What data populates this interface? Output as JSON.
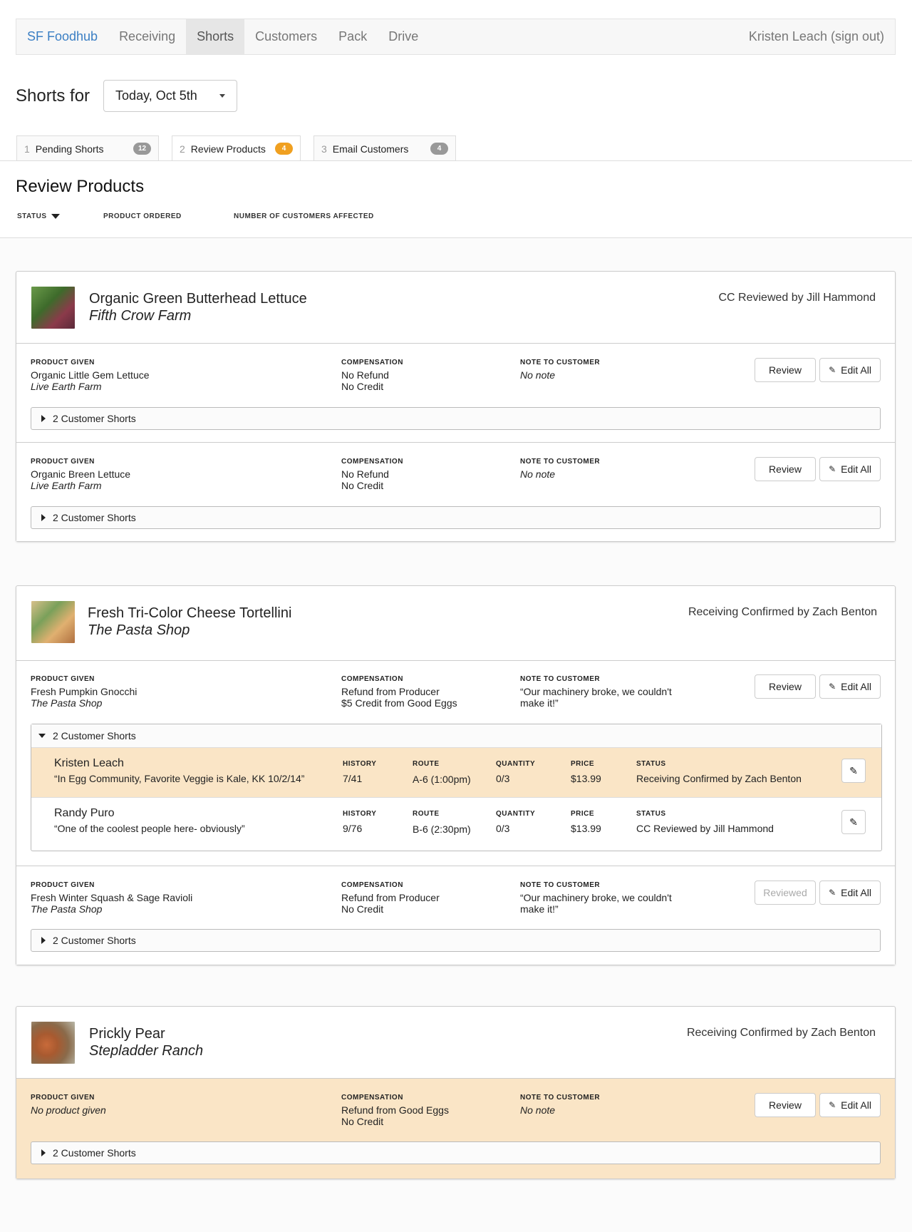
{
  "nav": {
    "brand": "SF Foodhub",
    "items": [
      "Receiving",
      "Shorts",
      "Customers",
      "Pack",
      "Drive"
    ],
    "user": "Kristen Leach (sign out)"
  },
  "header": {
    "title": "Shorts for",
    "date": "Today, Oct 5th"
  },
  "tabs": [
    {
      "num": "1",
      "label": "Pending Shorts",
      "badge": "12"
    },
    {
      "num": "2",
      "label": "Review Products",
      "badge": "4"
    },
    {
      "num": "3",
      "label": "Email Customers",
      "badge": "4"
    }
  ],
  "review": {
    "title": "Review Products",
    "columns": [
      "STATUS",
      "PRODUCT ORDERED",
      "NUMBER OF CUSTOMERS AFFECTED"
    ]
  },
  "labels": {
    "product_given": "PRODUCT GIVEN",
    "compensation": "COMPENSATION",
    "note": "NOTE TO CUSTOMER",
    "review": "Review",
    "reviewed": "Reviewed",
    "edit_all": "Edit All",
    "history": "HISTORY",
    "route": "ROUTE",
    "quantity": "QUANTITY",
    "price": "PRICE",
    "status": "STATUS"
  },
  "cards": [
    {
      "name": "Organic Green Butterhead Lettuce",
      "farm": "Fifth Crow Farm",
      "status": "CC Reviewed by Jill Hammond",
      "subs": [
        {
          "given": "Organic Little Gem Lettuce",
          "given_farm": "Live Earth Farm",
          "comp1": "No Refund",
          "comp2": "No Credit",
          "note": "No note",
          "shorts": "2 Customer Shorts"
        },
        {
          "given": "Organic Breen Lettuce",
          "given_farm": "Live Earth Farm",
          "comp1": "No Refund",
          "comp2": "No Credit",
          "note": "No note",
          "shorts": "2 Customer Shorts"
        }
      ]
    },
    {
      "name": "Fresh Tri-Color Cheese Tortellini",
      "farm": "The Pasta Shop",
      "status": "Receiving Confirmed by Zach Benton",
      "subs": [
        {
          "given": "Fresh Pumpkin Gnocchi",
          "given_farm": "The Pasta Shop",
          "comp1": "Refund from Producer",
          "comp2": "$5 Credit from Good Eggs",
          "note1": "“Our machinery broke, we couldn't",
          "note2": "make it!”",
          "shorts": "2 Customer Shorts",
          "customers": [
            {
              "name": "Kristen Leach",
              "note": "“In Egg Community, Favorite Veggie is Kale, KK 10/2/14”",
              "history": "7/41",
              "route": "A-6 (1:00pm)",
              "quantity": "0/3",
              "price": "$13.99",
              "status": "Receiving Confirmed by Zach Benton"
            },
            {
              "name": "Randy Puro",
              "note": "“One of the coolest people here- obviously”",
              "history": "9/76",
              "route": "B-6 (2:30pm)",
              "quantity": "0/3",
              "price": "$13.99",
              "status": "CC Reviewed by Jill Hammond"
            }
          ]
        },
        {
          "given": "Fresh Winter Squash & Sage Ravioli",
          "given_farm": "The Pasta Shop",
          "comp1": "Refund from Producer",
          "comp2": "No Credit",
          "note1": "“Our machinery broke, we couldn't",
          "note2": "make it!”",
          "shorts": "2 Customer Shorts"
        }
      ]
    },
    {
      "name": "Prickly Pear",
      "farm": "Stepladder Ranch",
      "status": "Receiving Confirmed by Zach Benton",
      "subs": [
        {
          "given": "No product given",
          "comp1": "Refund from Good Eggs",
          "comp2": "No Credit",
          "note": "No note",
          "shorts": "2 Customer Shorts"
        }
      ]
    }
  ]
}
